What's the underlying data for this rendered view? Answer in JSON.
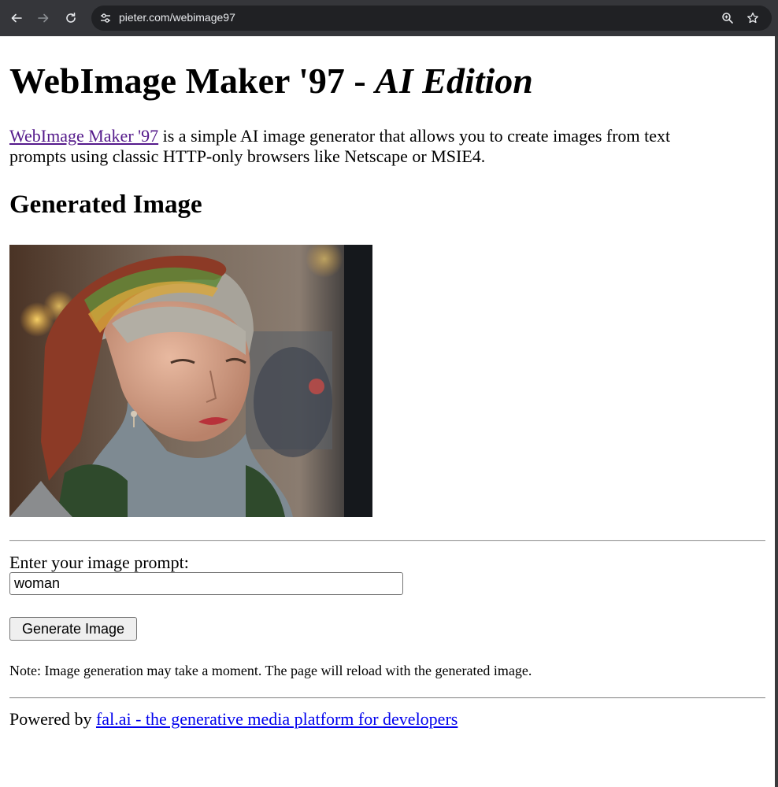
{
  "browser": {
    "url": "pieter.com/webimage97",
    "back_icon": "arrow-left-icon",
    "forward_icon": "arrow-right-icon",
    "reload_icon": "reload-icon",
    "site_info_icon": "tune-icon",
    "zoom_icon": "zoom-icon",
    "bookmark_icon": "star-icon"
  },
  "page": {
    "title_main": "WebImage Maker '97 - ",
    "title_italic": "AI Edition",
    "intro_link": "WebImage Maker '97",
    "intro_text": " is a simple AI image generator that allows you to create images from text prompts using classic HTTP-only browsers like Netscape or MSIE4.",
    "section_heading": "Generated Image",
    "prompt_label": "Enter your image prompt:",
    "prompt_value": "woman",
    "generate_button": "Generate Image",
    "note": "Note: Image generation may take a moment. The page will reload with the generated image.",
    "footer_prefix": "Powered by ",
    "footer_link": "fal.ai - the generative media platform for developers"
  },
  "colors": {
    "link": "#0000ee",
    "visited_link": "#551a8b",
    "chrome_bg": "#35363a",
    "omnibox_bg": "#202124"
  }
}
